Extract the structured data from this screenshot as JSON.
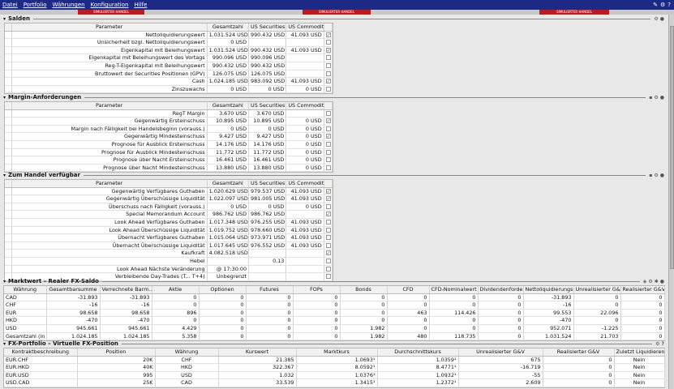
{
  "menu": [
    "Datei",
    "Portfolio",
    "Währungen",
    "Konfiguration",
    "Hilfe"
  ],
  "sim_label": "SIMULIERTER HANDEL",
  "sections": {
    "salden": {
      "title": "Salden",
      "headers": [
        "Parameter",
        "Gesamtzahl",
        "US Securities",
        "US Commodities"
      ],
      "rows": [
        [
          "Nettoliquidierungswert",
          "1.031.524 USD",
          "990.432 USD",
          "41.093 USD",
          true
        ],
        [
          "Unsicherheit bzgl. Nettoliquidierungswert",
          "0 USD",
          "",
          "",
          false
        ],
        [
          "Eigenkapital mit Beleihungswert",
          "1.031.524 USD",
          "990.432 USD",
          "41.093 USD",
          true
        ],
        [
          "Eigenkapital mit Beleihungswert des Vortags",
          "990.096 USD",
          "990.096 USD",
          "",
          false
        ],
        [
          "Reg-T-Eigenkapital mit Beleihungswert",
          "990.432 USD",
          "990.432 USD",
          "",
          false
        ],
        [
          "Bruttowert der Securities Positionen (GPV)",
          "126.075 USD",
          "126.075 USD",
          "",
          false
        ],
        [
          "Cash",
          "1.024.185 USD",
          "983.092 USD",
          "41.093 USD",
          true
        ],
        [
          "Zinszuwachs",
          "0 USD",
          "0 USD",
          "0 USD",
          false
        ]
      ]
    },
    "margin": {
      "title": "Margin-Anforderungen",
      "headers": [
        "Parameter",
        "Gesamtzahl",
        "US Securities",
        "US Commodities"
      ],
      "rows": [
        [
          "RegT Margin",
          "3.670 USD",
          "3.670 USD",
          "",
          false
        ],
        [
          "Gegenwärtig Ersteinschuss",
          "10.895 USD",
          "10.895 USD",
          "0 USD",
          true
        ],
        [
          "Margin nach Fälligkeit bei Handelsbeginn (vorauss.)",
          "0 USD",
          "0 USD",
          "0 USD",
          false
        ],
        [
          "Gegenwärtig Mindesteinschuss",
          "9.427 USD",
          "9.427 USD",
          "0 USD",
          true
        ],
        [
          "Prognose für Ausblick Ersteinschuss",
          "14.176 USD",
          "14.176 USD",
          "0 USD",
          false
        ],
        [
          "Prognose für Ausblick Mindesteinschuss",
          "11.772 USD",
          "11.772 USD",
          "0 USD",
          false
        ],
        [
          "Prognose über Nacht Ersteinschuss",
          "16.461 USD",
          "16.461 USD",
          "0 USD",
          false
        ],
        [
          "Prognose über Nacht Mindesteinschuss",
          "13.880 USD",
          "13.880 USD",
          "0 USD",
          false
        ]
      ]
    },
    "handel": {
      "title": "Zum Handel verfügbar",
      "headers": [
        "Parameter",
        "Gesamtzahl",
        "US Securities",
        "US Commodities"
      ],
      "rows": [
        [
          "Gegenwärtig Verfügbares Guthaben",
          "1.020.629 USD",
          "979.537 USD",
          "41.093 USD",
          true
        ],
        [
          "Gegenwärtig Überschüssige Liquidität",
          "1.022.097 USD",
          "981.005 USD",
          "41.093 USD",
          true
        ],
        [
          "Überschuss nach Fälligkeit (vorauss.)",
          "0 USD",
          "0 USD",
          "0 USD",
          false
        ],
        [
          "Special Memorandum Account",
          "986.762 USD",
          "986.762 USD",
          "",
          true
        ],
        [
          "Look Ahead Verfügbares Guthaben",
          "1.017.348 USD",
          "976.255 USD",
          "41.093 USD",
          false
        ],
        [
          "Look Ahead Überschüssige Liquidität",
          "1.019.752 USD",
          "978.660 USD",
          "41.093 USD",
          false
        ],
        [
          "Übernacht Verfügbares Guthaben",
          "1.015.064 USD",
          "973.971 USD",
          "41.093 USD",
          false
        ],
        [
          "Übernacht Überschüssige Liquidität",
          "1.017.645 USD",
          "976.552 USD",
          "41.093 USD",
          false
        ],
        [
          "Kaufkraft",
          "4.082.518 USD",
          "",
          "",
          true
        ],
        [
          "Hebel",
          "",
          "0.13",
          "",
          false
        ],
        [
          "Look Ahead Nächste Veränderung",
          "@ 17:30:00",
          "",
          "",
          false
        ],
        [
          "Verbleibende Day-Trades (T... T+4)",
          "Unbegrenzt",
          "",
          "",
          false
        ]
      ]
    },
    "fx": {
      "title": "Marktwert – Realer FX-Saldo",
      "headers": [
        "Währung",
        "Gesamtbarsumme",
        "Verrechnete Barm...",
        "Aktie",
        "Optionen",
        "Futures",
        "FOPs",
        "Bonds",
        "CFD",
        "CFD-Nominalwert",
        "Dividendenforderu...",
        "Nettoliquidierungs...",
        "Unrealisierter G&V",
        "Realisierter G&V"
      ],
      "rows": [
        [
          "CAD",
          "-31.893",
          "-31.893",
          "0",
          "0",
          "0",
          "0",
          "0",
          "0",
          "0",
          "0",
          "-31.893",
          "0",
          "0"
        ],
        [
          "CHF",
          "-16",
          "-16",
          "0",
          "0",
          "0",
          "0",
          "0",
          "0",
          "0",
          "0",
          "-16",
          "0",
          "0"
        ],
        [
          "EUR",
          "98.658",
          "98.658",
          "896",
          "0",
          "0",
          "0",
          "0",
          "463",
          "114.426",
          "0",
          "99.553",
          "22.096",
          "0"
        ],
        [
          "HKD",
          "-470",
          "-470",
          "0",
          "0",
          "0",
          "0",
          "0",
          "0",
          "0",
          "0",
          "-470",
          "0",
          "0"
        ],
        [
          "USD",
          "945.661",
          "945.661",
          "4.429",
          "0",
          "0",
          "0",
          "1.982",
          "0",
          "0",
          "0",
          "952.071",
          "-1.225",
          "0"
        ],
        [
          "Gesamtzahl (in ...",
          "1.024.185",
          "1.024.185",
          "5.358",
          "0",
          "0",
          "0",
          "1.982",
          "480",
          "118.735",
          "0",
          "1.031.524",
          "21.703",
          "0"
        ]
      ]
    },
    "fxport": {
      "title": "FX-Portfolio – Virtuelle FX-Position",
      "headers": [
        "Kontraktbeschreibung",
        "Position",
        "Währung",
        "Kurswert",
        "Marktkurs",
        "Durchschnittskurs",
        "Unrealisierter G&V",
        "Realisierter G&V",
        "Zuletzt Liquidieren"
      ],
      "rows": [
        [
          "EUR.CHF",
          "20K",
          "CHF",
          "21.385",
          "1.0693¹",
          "1.0359¹",
          "675",
          "0",
          "Nein"
        ],
        [
          "EUR.HKD",
          "40K",
          "HKD",
          "322.367",
          "8.0592¹",
          "8.4771¹",
          "-16.719",
          "0",
          "Nein"
        ],
        [
          "EUR.USD",
          "995",
          "USD",
          "1.032",
          "1.0376¹",
          "1.0932¹",
          "-55",
          "0",
          "Nein"
        ],
        [
          "USD.CAD",
          "25K",
          "CAD",
          "33.539",
          "1.3415¹",
          "1.2372¹",
          "2.609",
          "0",
          "Nein"
        ]
      ]
    }
  }
}
